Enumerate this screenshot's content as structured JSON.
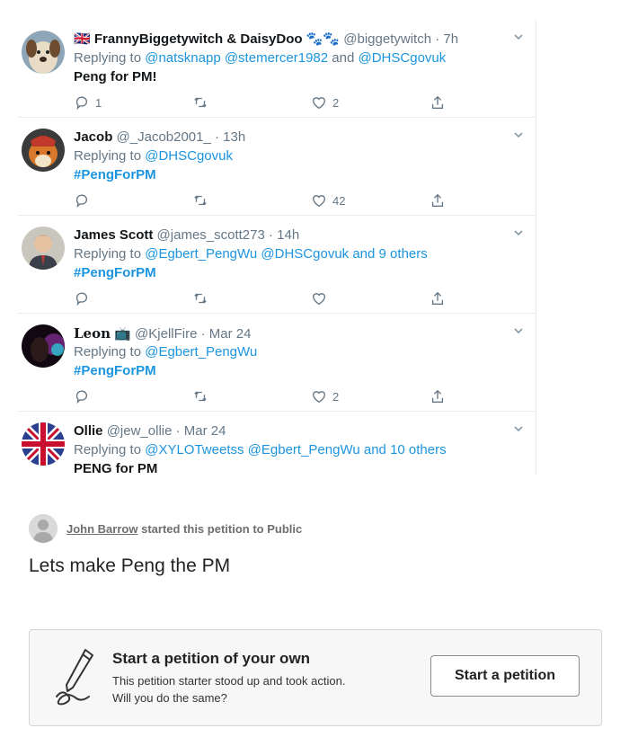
{
  "colors": {
    "link": "#1b95e0",
    "muted": "#657786",
    "divider": "#e6ecf0",
    "cta_bg": "#f7f7f7"
  },
  "tweets": [
    {
      "flag": "🇬🇧",
      "name": "FrannyBiggetywitch & DaisyDoo",
      "name_suffix": "🐾🐾",
      "handle": "@biggetywitch",
      "time": "· 7h",
      "replying_prefix": "Replying to",
      "mentions": "@natsknapp @stemercer1982",
      "and_text": "and",
      "mentions_tail": "@DHSCgovuk",
      "body": "Peng for PM!",
      "body_style": "plain",
      "reply_count": "1",
      "retweet_count": "",
      "like_count": "2",
      "avatar_icon": "dog-avatar-icon"
    },
    {
      "flag": "",
      "name": "Jacob",
      "name_suffix": "",
      "handle": "@_Jacob2001_",
      "time": "· 13h",
      "replying_prefix": "Replying to",
      "mentions": "@DHSCgovuk",
      "and_text": "",
      "mentions_tail": "",
      "body": "#PengForPM",
      "body_style": "hash",
      "reply_count": "",
      "retweet_count": "",
      "like_count": "42",
      "avatar_icon": "shiba-avatar-icon"
    },
    {
      "flag": "",
      "name": "James Scott",
      "name_suffix": "",
      "handle": "@james_scott273",
      "time": "· 14h",
      "replying_prefix": "Replying to",
      "mentions": "@Egbert_PengWu @DHSCgovuk",
      "and_text": "and",
      "mentions_tail": "9 others",
      "body": "#PengForPM",
      "body_style": "hash",
      "reply_count": "",
      "retweet_count": "",
      "like_count": "",
      "avatar_icon": "person-avatar-icon"
    },
    {
      "flag": "",
      "name": "Leon",
      "name_suffix": "📺",
      "handle": "@KjellFire",
      "time": "· Mar 24",
      "replying_prefix": "Replying to",
      "mentions": "@Egbert_PengWu",
      "and_text": "",
      "mentions_tail": "",
      "body": "#PengForPM",
      "body_style": "hash",
      "reply_count": "",
      "retweet_count": "",
      "like_count": "2",
      "avatar_icon": "dark-avatar-icon"
    },
    {
      "flag": "",
      "name": "Ollie",
      "name_suffix": "",
      "handle": "@jew_ollie",
      "time": "· Mar 24",
      "replying_prefix": "Replying to",
      "mentions": "@XYLOTweetss @Egbert_PengWu",
      "and_text": "and",
      "mentions_tail": "10 others",
      "body": "PENG for PM",
      "body_style": "plain",
      "reply_count": "",
      "retweet_count": "",
      "like_count": "",
      "avatar_icon": "union-jack-avatar-icon"
    }
  ],
  "petition": {
    "starter_name": "John Barrow",
    "started_text": "started this petition to Public",
    "title": "Lets make Peng the PM"
  },
  "cta": {
    "heading": "Start a petition of your own",
    "line1": "This petition starter stood up and took action.",
    "line2": "Will you do the same?",
    "button_label": "Start a petition"
  }
}
